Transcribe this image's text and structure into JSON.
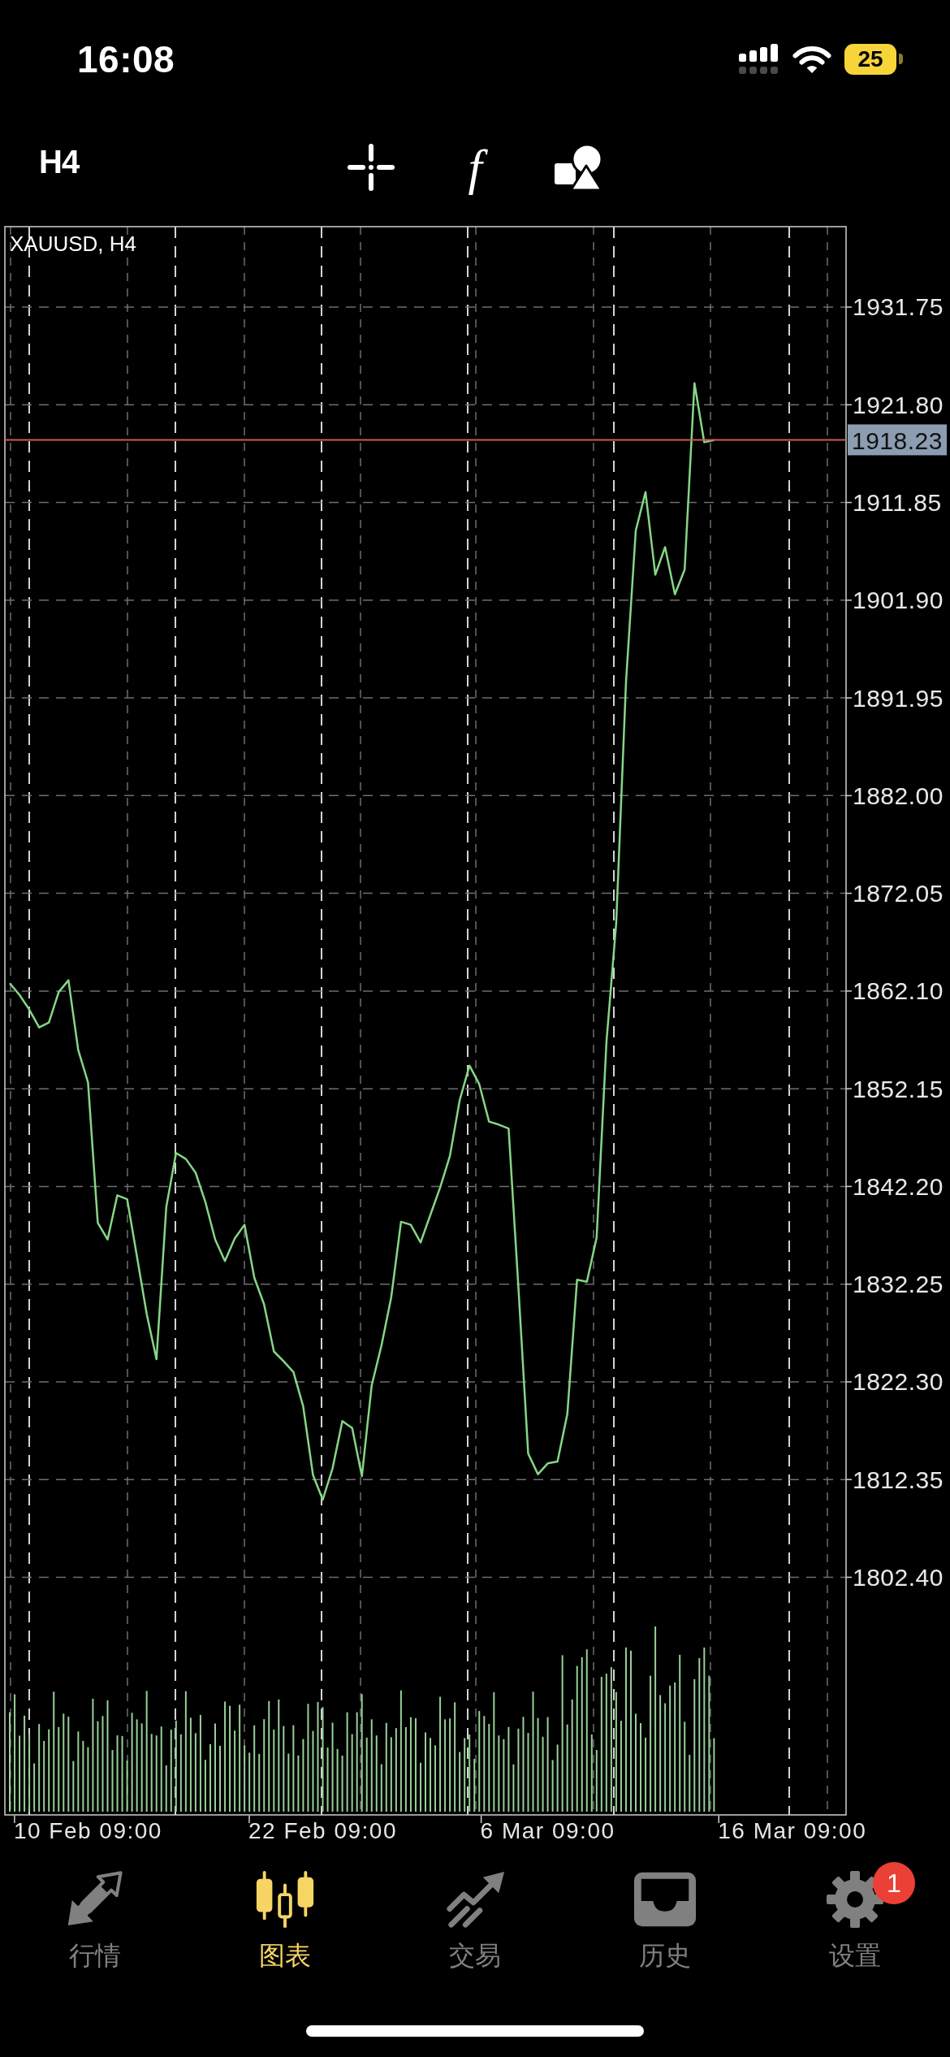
{
  "status_bar": {
    "time": "16:08",
    "battery": "25"
  },
  "toolbar": {
    "timeframe": "H4",
    "indicator_glyph": "f"
  },
  "chart": {
    "chart_data": {
      "type": "line",
      "title": "XAUUSD, H4",
      "grid": true,
      "ylim": [
        1778.2,
        1939.94
      ],
      "categories": [
        null,
        null,
        null,
        null,
        null,
        null,
        null,
        null,
        "10 Feb 09:00",
        null,
        null,
        null,
        null,
        null,
        null,
        null,
        null,
        null,
        null,
        null,
        null,
        null,
        null,
        null,
        null,
        null,
        null,
        null,
        null,
        null,
        null,
        null,
        "22 Feb 09:00",
        null,
        null,
        null,
        null,
        null,
        null,
        null,
        null,
        null,
        null,
        null,
        null,
        null,
        null,
        null,
        null,
        null,
        null,
        null,
        null,
        null,
        null,
        "6 Mar 09:00",
        null,
        null,
        null,
        null,
        null,
        null,
        null,
        null,
        null,
        null,
        null,
        null,
        null,
        null,
        null,
        null,
        null,
        null,
        null,
        null,
        null,
        null,
        null,
        null,
        "16 Mar 09:00",
        null,
        null,
        null,
        null,
        null
      ],
      "yticks": [
        {
          "value": 1931.75,
          "label": "1931.75"
        },
        {
          "value": 1921.8,
          "label": "1921.80"
        },
        {
          "value": 1911.85,
          "label": "1911.85"
        },
        {
          "value": 1901.9,
          "label": "1901.90"
        },
        {
          "value": 1891.95,
          "label": "1891.95"
        },
        {
          "value": 1882,
          "label": "1882.00"
        },
        {
          "value": 1872.05,
          "label": "1872.05"
        },
        {
          "value": 1862.1,
          "label": "1862.10"
        },
        {
          "value": 1852.15,
          "label": "1852.15"
        },
        {
          "value": 1842.2,
          "label": "1842.20"
        },
        {
          "value": 1832.25,
          "label": "1832.25"
        },
        {
          "value": 1822.3,
          "label": "1822.30"
        },
        {
          "value": 1812.35,
          "label": "1812.35"
        },
        {
          "value": 1802.4,
          "label": "1802.40"
        }
      ],
      "series": [
        {
          "color": "#86d686",
          "values": [
            1862.9,
            1861.7,
            1860.2,
            1858.4,
            1858.9,
            1862.0,
            1863.2,
            1856.1,
            1852.8,
            1838.5,
            1836.8,
            1841.3,
            1840.9,
            1835.1,
            1829.2,
            1824.6,
            1840.1,
            1845.6,
            1845.0,
            1843.6,
            1840.6,
            1836.8,
            1834.6,
            1836.9,
            1838.3,
            1832.9,
            1830.2,
            1825.4,
            1824.4,
            1823.3,
            1819.8,
            1812.8,
            1810.3,
            1813.5,
            1818.3,
            1817.6,
            1812.7,
            1821.9,
            1826.0,
            1830.9,
            1838.6,
            1838.3,
            1836.5,
            1839.3,
            1842.1,
            1845.3,
            1851.0,
            1854.5,
            1852.6,
            1848.8,
            1848.5,
            1848.1,
            1832.0,
            1815.0,
            1812.9,
            1814.0,
            1814.2,
            1819.0,
            1832.7,
            1832.5,
            1837.0,
            1856.9,
            1869.0,
            1893.6,
            1909.0,
            1912.9,
            1904.5,
            1907.3,
            1902.5,
            1905.0,
            1924.0,
            1918.0,
            1918.2,
            null,
            null,
            null,
            null,
            null,
            null,
            null,
            null,
            null,
            null,
            null,
            null,
            null
          ]
        }
      ],
      "ref_lines": [
        {
          "axis": "y",
          "value": 1918.23,
          "label": "1918.23",
          "color": "#d05a55"
        }
      ]
    }
  },
  "tab_bar": [
    {
      "kind": "quotes",
      "label": "行情",
      "selected": false
    },
    {
      "kind": "chart",
      "label": "图表",
      "selected": true
    },
    {
      "kind": "trade",
      "label": "交易",
      "selected": false
    },
    {
      "kind": "history",
      "label": "历史",
      "selected": false
    },
    {
      "kind": "settings",
      "label": "设置",
      "selected": false,
      "badge": "1"
    }
  ]
}
